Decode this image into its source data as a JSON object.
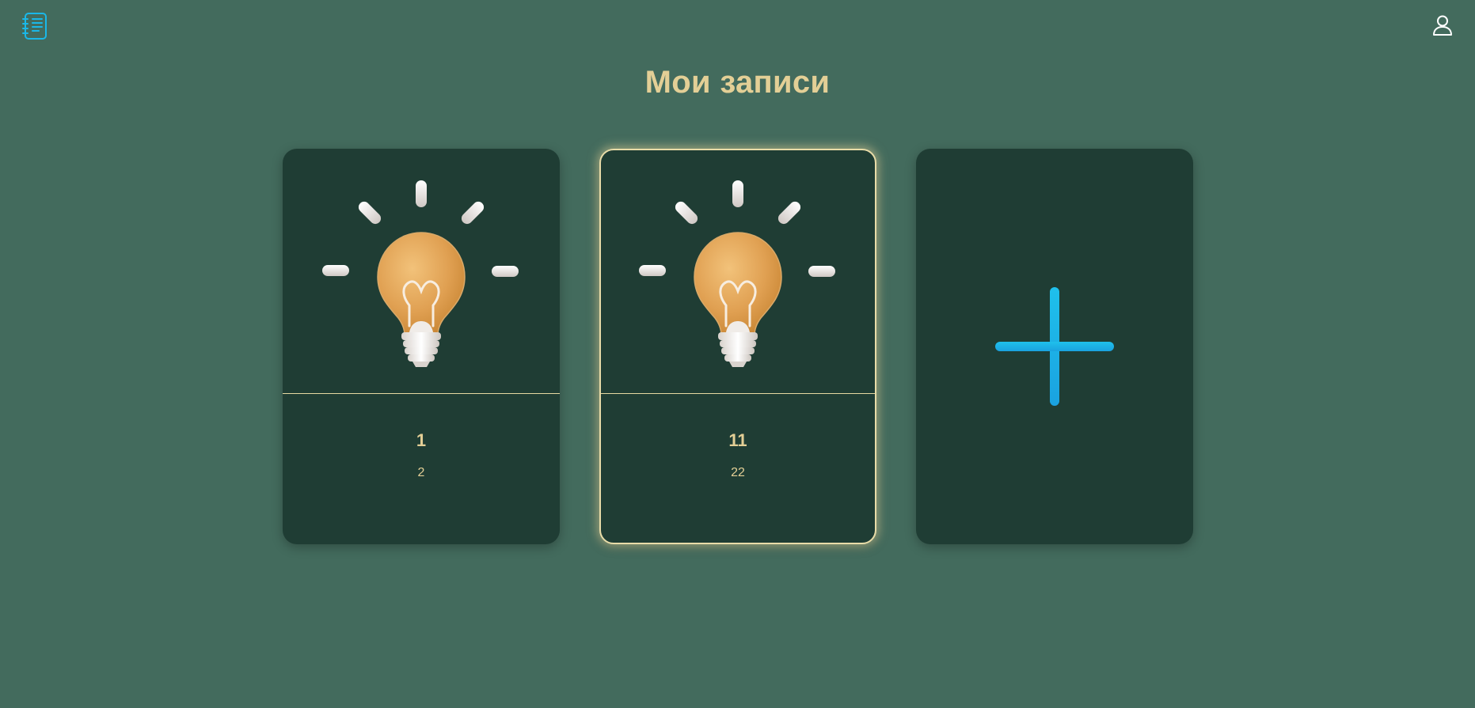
{
  "header": {
    "logo_icon": "notebook-icon",
    "user_icon": "user-icon"
  },
  "page": {
    "title": "Мои записи"
  },
  "notes": [
    {
      "title": "1",
      "subtitle": "2",
      "image_icon": "lightbulb-icon",
      "selected": false
    },
    {
      "title": "11",
      "subtitle": "22",
      "image_icon": "lightbulb-icon",
      "selected": true
    }
  ],
  "add_card": {
    "icon": "plus-icon"
  },
  "colors": {
    "background": "#436b5d",
    "card": "#1f3d34",
    "accent_text": "#e3cf96",
    "plus": "#1ab8e8"
  }
}
